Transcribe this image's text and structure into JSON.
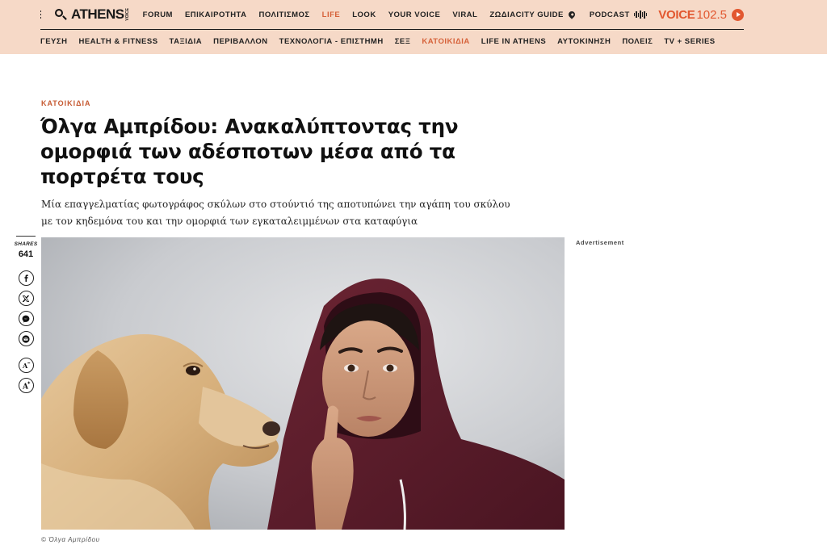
{
  "header": {
    "logo_text": "ATHENS",
    "logo_small": "VOICE",
    "main_nav": [
      {
        "label": "FORUM",
        "active": false
      },
      {
        "label": "ΕΠΙΚΑΙΡΟΤΗΤΑ",
        "active": false
      },
      {
        "label": "ΠΟΛΙΤΙΣΜΟΣ",
        "active": false
      },
      {
        "label": "LIFE",
        "active": true
      },
      {
        "label": "LOOK",
        "active": false
      },
      {
        "label": "YOUR VOICE",
        "active": false
      },
      {
        "label": "VIRAL",
        "active": false
      },
      {
        "label": "ΖΩΔΙΑ",
        "active": false
      }
    ],
    "city_guide": "CITY GUIDE",
    "podcast": "PODCAST",
    "radio_brand": "VOICE",
    "radio_freq": "102.5",
    "sub_nav": [
      {
        "label": "ΓΕΥΣΗ",
        "active": false
      },
      {
        "label": "HEALTH & FITNESS",
        "active": false
      },
      {
        "label": "ΤΑΞΙΔΙΑ",
        "active": false
      },
      {
        "label": "ΠΕΡΙΒΑΛΛΟΝ",
        "active": false
      },
      {
        "label": "ΤΕΧΝΟΛΟΓΙΑ - ΕΠΙΣΤΗΜΗ",
        "active": false
      },
      {
        "label": "ΣΕΞ",
        "active": false
      },
      {
        "label": "ΚΑΤΟΙΚΙΔΙΑ",
        "active": true
      },
      {
        "label": "LIFE IN ATHENS",
        "active": false
      },
      {
        "label": "ΑΥΤΟΚΙΝΗΣΗ",
        "active": false
      },
      {
        "label": "ΠΟΛΕΙΣ",
        "active": false
      },
      {
        "label": "TV + SERIES",
        "active": false
      }
    ]
  },
  "article": {
    "category": "ΚΑΤΟΙΚΙΔΙΑ",
    "title": "Όλγα Αμπρίδου: Ανακαλύπτοντας την ομορφιά των αδέσποτων μέσα από τα πορτρέτα τους",
    "subtitle": "Μία επαγγελματίας φωτογράφος σκύλων στο στούντιό της αποτυπώνει την αγάπη του σκύλου με τον κηδεμόνα του και την ομορφιά των εγκαταλειμμένων στα καταφύγια",
    "image_caption": "© Όλγα Αμπρίδου"
  },
  "share": {
    "label": "SHARES",
    "count": "641",
    "buttons": [
      "facebook-icon",
      "x-icon",
      "messenger-icon",
      "email-icon",
      "font-decrease-icon",
      "font-increase-icon"
    ]
  },
  "sidebar": {
    "ad_label": "Advertisement"
  },
  "colors": {
    "header_bg": "#f6d9c7",
    "accent": "#d6623a",
    "radio_accent": "#e2572f"
  }
}
